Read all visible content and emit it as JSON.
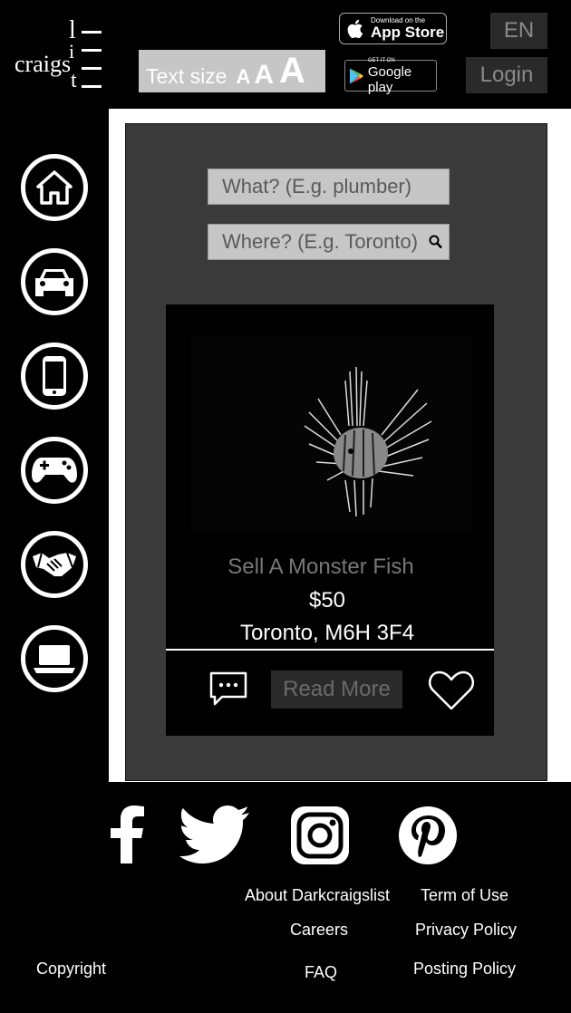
{
  "header": {
    "logo": {
      "top_letter": "l",
      "middle_letter": "i",
      "word": "craigs",
      "bottom_letter": "t"
    },
    "text_size": {
      "label": "Text size",
      "small": "A",
      "medium": "A",
      "large": "A"
    },
    "app_store": {
      "small": "Download on the",
      "big": "App Store"
    },
    "google_play": {
      "small": "GET IT ON",
      "big": "Google play"
    },
    "language": "EN",
    "login": "Login"
  },
  "sidebar": {
    "items": [
      {
        "name": "home",
        "icon": "home-icon"
      },
      {
        "name": "cars",
        "icon": "car-icon"
      },
      {
        "name": "phones",
        "icon": "phone-icon"
      },
      {
        "name": "games",
        "icon": "gamepad-icon"
      },
      {
        "name": "services",
        "icon": "handshake-icon"
      },
      {
        "name": "computers",
        "icon": "laptop-icon"
      }
    ]
  },
  "search": {
    "what_placeholder": "What? (E.g. plumber)",
    "where_placeholder": "Where? (E.g. Toronto)"
  },
  "listing": {
    "title": "Sell A Monster Fish",
    "price": "$50",
    "location": "Toronto, M6H 3F4",
    "read_more": "Read More"
  },
  "footer": {
    "social": [
      "facebook-icon",
      "twitter-icon",
      "instagram-icon",
      "pinterest-icon"
    ],
    "links": {
      "about": "About Darkcraigslist",
      "terms": "Term of Use",
      "careers": "Careers",
      "privacy": "Privacy Policy",
      "copyright": "Copyright",
      "faq": "FAQ",
      "posting": "Posting Policy"
    }
  },
  "colors": {
    "background": "#000000",
    "panel": "#3a3a3a",
    "input": "#c6c6c6",
    "button": "#2a2a2a"
  }
}
